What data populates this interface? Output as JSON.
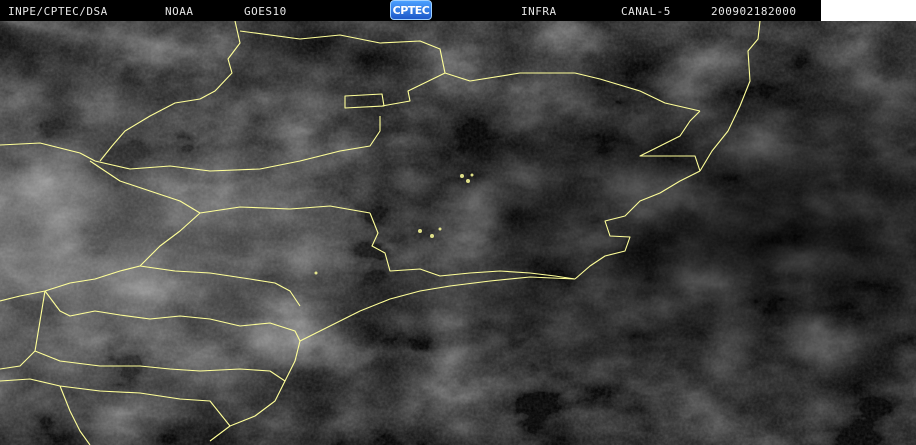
{
  "header": {
    "source": "INPE/CPTEC/DSA",
    "agency": "NOAA",
    "satellite": "GOES10",
    "logo_text": "CPTEC",
    "product": "INFRA",
    "channel": "CANAL-5",
    "datetime": "200902182000"
  },
  "colors": {
    "background": "#000000",
    "header_text": "#e6e6e6",
    "borders": "#ffff99",
    "logo_blue": "#1d58c8"
  },
  "map": {
    "type": "satellite-infrared-image",
    "overlay": "state-borders"
  }
}
